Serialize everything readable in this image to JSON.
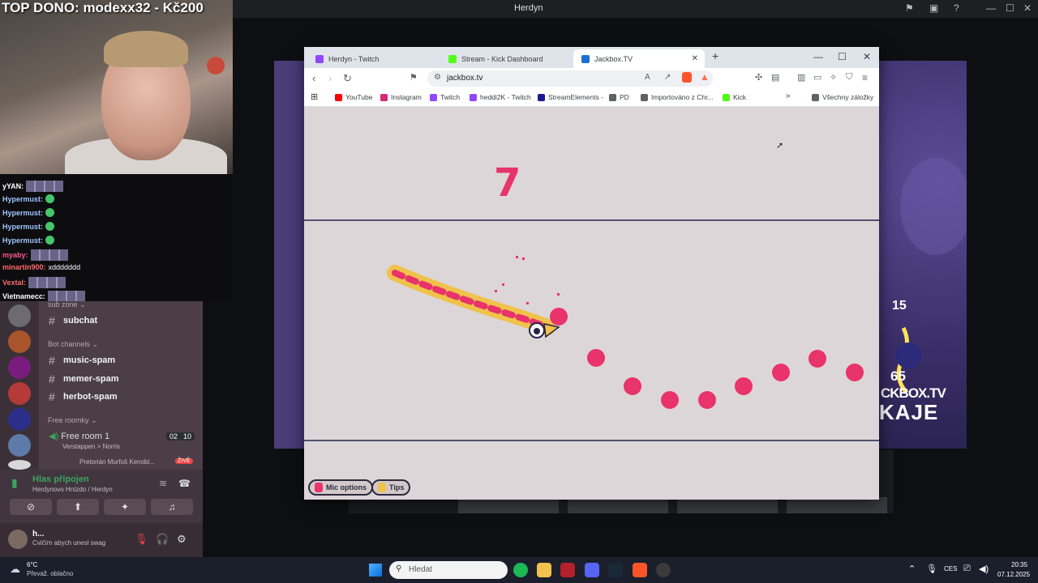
{
  "host_window": {
    "title": "Herdyn"
  },
  "overlay": {
    "top_donation": "TOP DONO: modexx32 - Kč200"
  },
  "twitch_chat": [
    {
      "name": "yYAN:",
      "color": "#ffffff",
      "message": ""
    },
    {
      "name": "Hypermust:",
      "color": "#9ec5ff",
      "message": ""
    },
    {
      "name": "Hypermust:",
      "color": "#9ec5ff",
      "message": ""
    },
    {
      "name": "Hypermust:",
      "color": "#9ec5ff",
      "message": ""
    },
    {
      "name": "Hypermust:",
      "color": "#9ec5ff",
      "message": ""
    },
    {
      "name": "myaby:",
      "color": "#ff5a8a",
      "message": ""
    },
    {
      "name": "minartin900:",
      "color": "#ff6b6b",
      "message": "xddddddd"
    },
    {
      "name": "Vextal:",
      "color": "#ff6b6b",
      "message": ""
    },
    {
      "name": "Vietnamecc:",
      "color": "#ffffff",
      "message": ""
    }
  ],
  "discord": {
    "categories": {
      "sub_zone": "sub zone",
      "bot_channels": "Bot channels",
      "free_roomky": "Free roomky"
    },
    "channels": {
      "subchat": "subchat",
      "music_spam": "music-spam",
      "memer_spam": "memer-spam",
      "herbot_spam": "herbot-spam"
    },
    "voice_channel": {
      "name": "Free room 1",
      "count_a": "02",
      "count_b": "10",
      "activity": "Verstappen > Norris",
      "member": "Pretorián Murfoš Kenobi...",
      "live_badge": "ŽIVĚ"
    },
    "voice_status": {
      "status": "Hlas připojen",
      "location": "Herdynovo Hnízdo / Herdyn"
    },
    "user": {
      "name": "h...",
      "status": "Cvičím abych unesl swag"
    }
  },
  "stream_side": {
    "score_top": "15",
    "score_mid": "65",
    "brand_line1": "CKBOX.TV",
    "brand_line2": "KAJE"
  },
  "browser": {
    "tabs": [
      {
        "label": "Herdyn - Twitch",
        "color": "#9146ff"
      },
      {
        "label": "Stream - Kick Dashboard",
        "color": "#53fc18"
      },
      {
        "label": "Jackbox.TV",
        "color": "#1f6fd6"
      }
    ],
    "url": "jackbox.tv",
    "bookmarks": [
      {
        "label": "YouTube",
        "color": "#ff0000"
      },
      {
        "label": "Instagram",
        "color": "#d62976"
      },
      {
        "label": "Twitch",
        "color": "#9146ff"
      },
      {
        "label": "heddi2K - Twitch",
        "color": "#9146ff"
      },
      {
        "label": "StreamElements -",
        "color": "#1b1b8c"
      },
      {
        "label": "PD",
        "color": "#5f6368"
      },
      {
        "label": "Importováno z Chr...",
        "color": "#5f6368"
      },
      {
        "label": "Kick",
        "color": "#53fc18"
      },
      {
        "label": "Všechny záložky",
        "color": "#5f6368"
      }
    ]
  },
  "game": {
    "number": "7",
    "mic_button": "Mic options",
    "tips_button": "Tips",
    "accent_color": "#e8336b",
    "dots": 9
  },
  "taskbar": {
    "weather_temp": "6°C",
    "weather_desc": "Převaž. oblačno",
    "search_placeholder": "Hledat",
    "language": "CES",
    "time": "20:35",
    "date": "07.12.2025"
  }
}
